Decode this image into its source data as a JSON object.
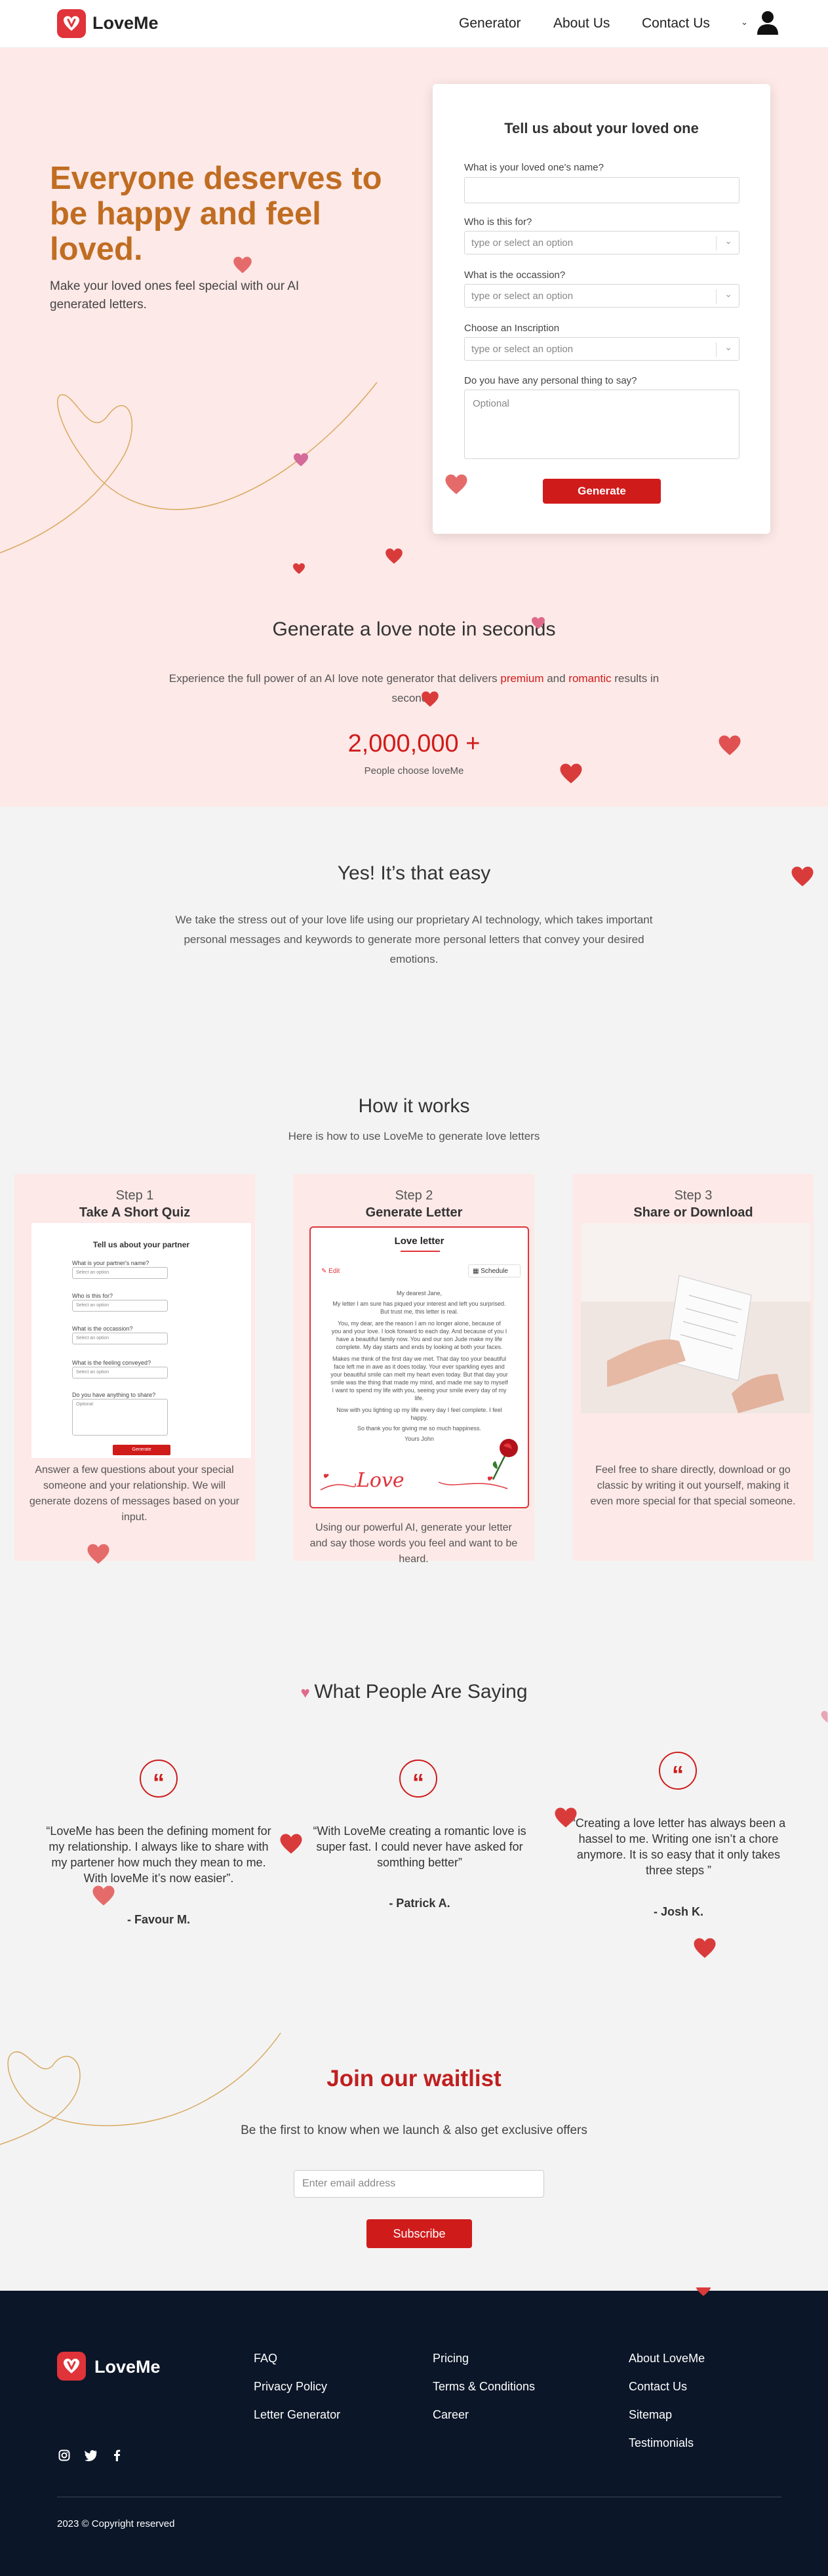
{
  "header": {
    "brand": "LoveMe",
    "nav": [
      "Generator",
      "About Us",
      "Contact Us"
    ]
  },
  "hero": {
    "headline": "Everyone deserves to be happy and feel loved.",
    "subtext": "Make your loved ones feel special with our AI generated letters."
  },
  "form": {
    "title": "Tell us about your loved one",
    "name_label": "What is your loved one's name?",
    "who_label": "Who is this for?",
    "who_placeholder": "type or select an option",
    "occasion_label": "What is the occassion?",
    "occasion_placeholder": "type or select an option",
    "inscription_label": "Choose an Inscription",
    "inscription_placeholder": "type or select an option",
    "personal_label": "Do you have any personal thing to say?",
    "personal_placeholder": "Optional",
    "submit": "Generate"
  },
  "generate_section": {
    "title": "Generate a love note in seconds",
    "text_before": "Experience the full power of an AI love note generator that delivers ",
    "highlight1": "premium",
    "text_mid": " and ",
    "highlight2": "romantic",
    "text_after": " results in seconds.",
    "stat_value": "2,000,000 +",
    "stat_label": "People choose loveMe"
  },
  "easy_section": {
    "title": "Yes! It’s that easy",
    "text": "We take the stress out of your love life using our proprietary AI technology, which takes important personal messages and keywords to generate more personal letters that convey your desired emotions."
  },
  "how_section": {
    "title": "How it works",
    "subtitle": "Here is how to use LoveMe to generate love letters",
    "steps": [
      {
        "number": "Step 1",
        "title": "Take A Short Quiz",
        "desc": "Answer a few questions about your special someone and your relationship. We will generate dozens of messages based on your input."
      },
      {
        "number": "Step 2",
        "title": "Generate Letter",
        "desc": "Using our powerful AI, generate your letter and say those words you feel and want to be heard."
      },
      {
        "number": "Step 3",
        "title": "Share or Download",
        "desc": "Feel free to share directly, download or go classic by writing it out yourself, making it even more special for that special someone."
      }
    ],
    "quiz_preview": {
      "title": "Tell us about your partner",
      "q1": "What is your partner's name?",
      "q2": "Who is this for?",
      "q3": "What is the occassion?",
      "q4": "What is the feeling conveyed?",
      "q5": "Do you have anything to share?",
      "option": "Select an option",
      "optional": "Optional",
      "button": "Generate"
    },
    "letter_preview": {
      "title": "Love letter",
      "edit": "Edit",
      "schedule": "Schedule",
      "greeting": "My dearest Jane,",
      "lines": [
        "My letter I am sure has piqued your interest and left you surprised.",
        "But trust me, this letter is real.",
        "You, my dear, are the reason I am no longer alone, because of",
        "you and your love. I look forward to each day. And because of you I",
        "have a beautiful family now. You and our son Jude make my life",
        "complete. My day starts and ends by looking at both your faces.",
        "Makes me think of the first day we met. That day too your beautiful",
        "face left me in awe as it does today. Your ever sparkling eyes and",
        "your beautiful smile can melt my heart even today. But that day your",
        "smile was the thing that made my mind, and made me say to myself",
        "I want to spend my life with you, seeing your smile every day of my",
        "life.",
        "Now with you lighting up my life every day I feel complete. I feel",
        "happy.",
        "So thank you for giving me so much happiness.",
        "Yours John"
      ],
      "signature": "Love"
    }
  },
  "testimonials": {
    "title": "What People Are Saying",
    "items": [
      {
        "quote": "“LoveMe has been the defining moment for my relationship. I always like to share with my partener how much they mean to me. With loveMe it’s now easier”.",
        "name": "- Favour M."
      },
      {
        "quote": "“With LoveMe creating a romantic love is super fast. I could never have asked for somthing better”",
        "name": "- Patrick A."
      },
      {
        "quote": "“Creating a love letter has always been a hassel to me. Writing one isn’t a chore anymore. It is so easy that it only takes three steps ”",
        "name": "- Josh K."
      }
    ]
  },
  "waitlist": {
    "title": "Join our waitlist",
    "subtitle": "Be the first to know when we launch & also get exclusive offers",
    "email_placeholder": "Enter email address",
    "button": "Subscribe"
  },
  "footer": {
    "brand": "LoveMe",
    "col1": [
      "FAQ",
      "Privacy Policy",
      "Letter Generator"
    ],
    "col2": [
      "Pricing",
      "Terms & Conditions",
      "Career"
    ],
    "col3": [
      "About LoveMe",
      "Contact Us",
      "Sitemap",
      "Testimonials"
    ],
    "copyright": "2023 © Copyright reserved"
  },
  "colors": {
    "accent_red": "#d01b1b",
    "headline_orange": "#c06d22",
    "hero_bg": "#fde9e7",
    "footer_bg": "#0b1628"
  }
}
